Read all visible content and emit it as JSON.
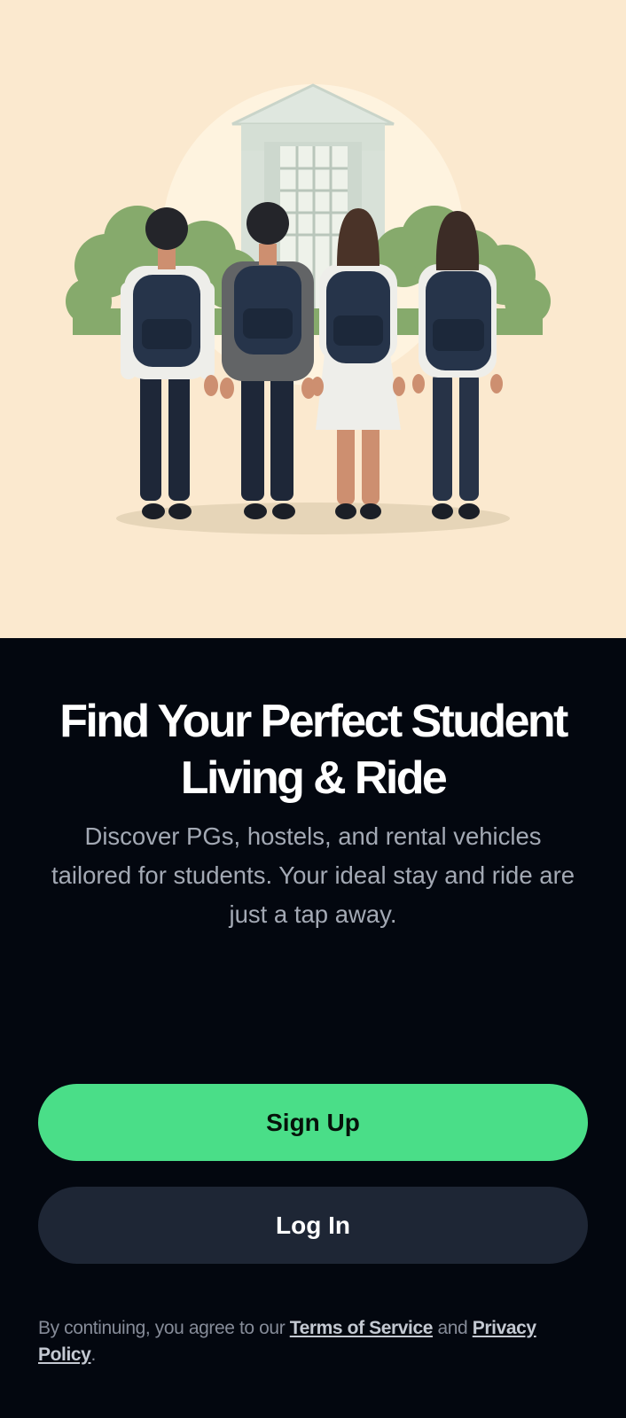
{
  "hero": {
    "illustration": "four-students-with-backpacks-facing-campus-building",
    "colors": {
      "background": "#fbe9cf",
      "glow": "#fef3df",
      "building": "#d5dfd5",
      "trees": "#86aa6c",
      "backpack": "#26344a",
      "pants": "#1e2738",
      "hair": "#24252a",
      "skin": "#cd8f70"
    }
  },
  "welcome": {
    "title": "Find Your Perfect Student Living & Ride",
    "subtitle": "Discover PGs, hostels, and rental vehicles tailored for students. Your ideal stay and ride are just a tap away."
  },
  "actions": {
    "signup_label": "Sign Up",
    "login_label": "Log In"
  },
  "legal": {
    "prefix": "By continuing, you agree to our ",
    "terms_label": "Terms of Service",
    "connector": " and ",
    "privacy_label": "Privacy Policy",
    "suffix": "."
  },
  "colors": {
    "page_background": "#03070f",
    "primary_button": "#4ade88",
    "secondary_button": "#1e2635",
    "title_text": "#ffffff",
    "body_text": "#a3a9b4"
  }
}
